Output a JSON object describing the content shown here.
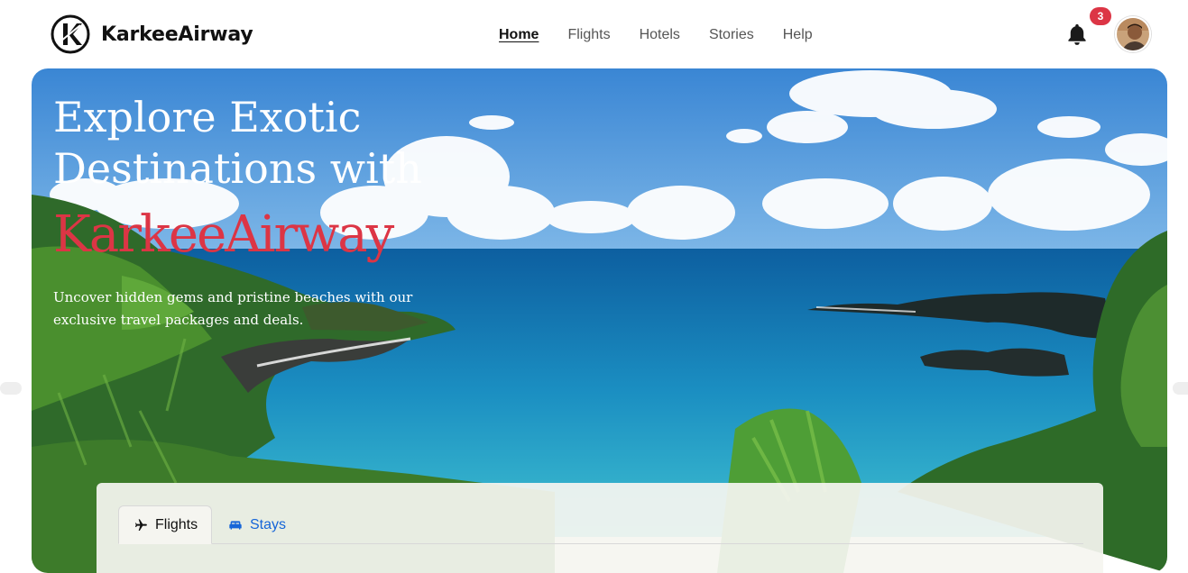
{
  "brand": {
    "name": "KarkeeAirway",
    "logo_icon": "k-logo-icon"
  },
  "nav": {
    "items": [
      {
        "label": "Home",
        "active": true
      },
      {
        "label": "Flights",
        "active": false
      },
      {
        "label": "Hotels",
        "active": false
      },
      {
        "label": "Stories",
        "active": false
      },
      {
        "label": "Help",
        "active": false
      }
    ]
  },
  "notifications": {
    "count": "3",
    "icon": "bell-icon"
  },
  "user": {
    "avatar_icon": "avatar"
  },
  "hero": {
    "title_line1": "Explore Exotic",
    "title_line2": "Destinations with",
    "brand": "KarkeeAirway",
    "subtitle": "Uncover hidden gems and pristine beaches with our exclusive travel packages and deals."
  },
  "search": {
    "tabs": [
      {
        "label": "Flights",
        "icon": "airplane-icon",
        "active": true
      },
      {
        "label": "Stays",
        "icon": "bed-icon",
        "active": false
      }
    ]
  },
  "colors": {
    "accent": "#dc3545",
    "link": "#1565d8",
    "badge": "#dc3545"
  }
}
